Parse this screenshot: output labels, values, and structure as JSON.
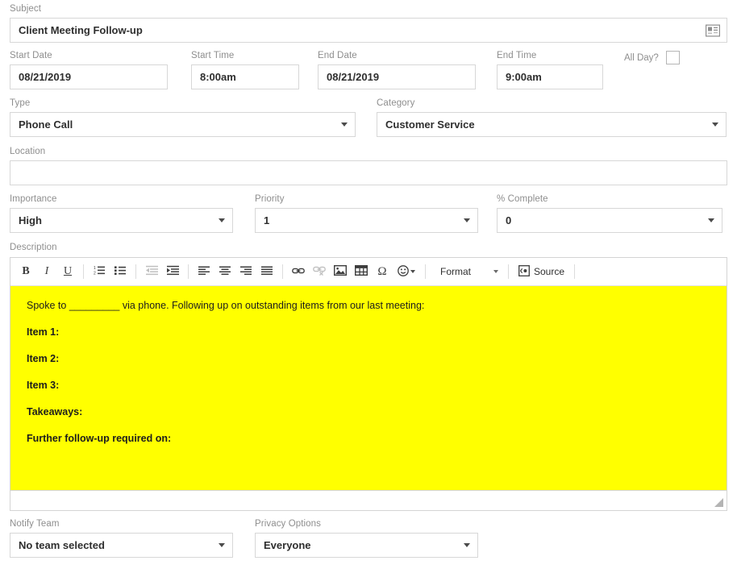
{
  "form": {
    "subject": {
      "label": "Subject",
      "value": "Client Meeting Follow-up",
      "icon": "contact-card-icon"
    },
    "start_date": {
      "label": "Start Date",
      "value": "08/21/2019"
    },
    "start_time": {
      "label": "Start Time",
      "value": "8:00am"
    },
    "end_date": {
      "label": "End Date",
      "value": "08/21/2019"
    },
    "end_time": {
      "label": "End Time",
      "value": "9:00am"
    },
    "all_day": {
      "label": "All Day?",
      "checked": false
    },
    "type": {
      "label": "Type",
      "value": "Phone Call"
    },
    "category": {
      "label": "Category",
      "value": "Customer Service"
    },
    "location": {
      "label": "Location",
      "value": "",
      "placeholder": ""
    },
    "importance": {
      "label": "Importance",
      "value": "High"
    },
    "priority": {
      "label": "Priority",
      "value": "1"
    },
    "percent_complete": {
      "label": "% Complete",
      "value": "0"
    },
    "description": {
      "label": "Description"
    },
    "notify_team": {
      "label": "Notify Team",
      "value": "No team selected"
    },
    "privacy": {
      "label": "Privacy Options",
      "value": "Everyone"
    }
  },
  "editor": {
    "toolbar": {
      "bold": "B",
      "italic": "I",
      "underline": "U",
      "numbered_list": "numbered-list-icon",
      "bulleted_list": "bulleted-list-icon",
      "outdent": "outdent-icon",
      "indent": "indent-icon",
      "align_left": "align-left-icon",
      "align_center": "align-center-icon",
      "align_right": "align-right-icon",
      "align_justify": "align-justify-icon",
      "link": "link-icon",
      "unlink": "unlink-icon",
      "image": "image-icon",
      "table": "table-icon",
      "special_char": "Ω",
      "smiley": "smiley-icon",
      "format_label": "Format",
      "source_label": "Source"
    },
    "background_color": "#FFFF00",
    "content": [
      {
        "text": "Spoke to _________ via phone. Following up on outstanding items from our last meeting:",
        "bold": false
      },
      {
        "text": "Item 1:",
        "bold": true
      },
      {
        "text": "Item 2:",
        "bold": true
      },
      {
        "text": "Item 3:",
        "bold": true
      },
      {
        "text": "Takeaways:",
        "bold": true
      },
      {
        "text": "Further follow-up required on:",
        "bold": true
      }
    ]
  },
  "colors": {
    "highlight": "#FFFF00",
    "border": "#d7d7d7",
    "label": "#8e8e8e",
    "text": "#2e2e2e"
  }
}
